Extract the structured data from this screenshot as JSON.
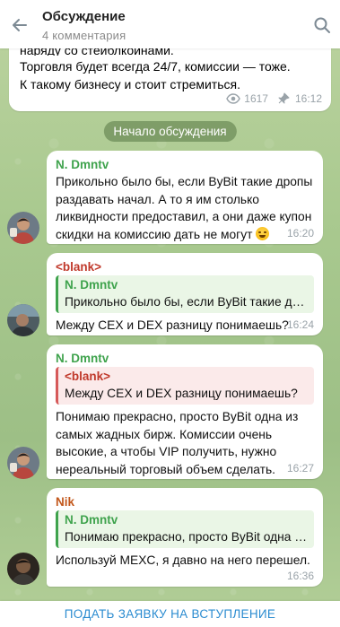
{
  "header": {
    "title": "Обсуждение",
    "subtitle": "4 комментария"
  },
  "post": {
    "cut_line": "наряду со стейблкоинами.",
    "line1": "Торговля будет всегда 24/7, комиссии — тоже.",
    "line2": "К такому бизнесу и стоит стремиться.",
    "views": "1617",
    "time": "16:12"
  },
  "service_message": "Начало обсуждения",
  "messages": [
    {
      "author": "N. Dmntv",
      "text": "Прикольно было бы, если ByBit такие дропы раздавать начал. А то я им столько ликвидности предоставил, а они даже купон скидки на комиссию дать не могут",
      "time": "16:20"
    },
    {
      "author": "<blank>",
      "reply_author": "N. Dmntv",
      "reply_text": "Прикольно было бы, если ByBit такие дро…",
      "text": "Между CEX и DEX разницу понимаешь?",
      "time": "16:24"
    },
    {
      "author": "N. Dmntv",
      "reply_author": "<blank>",
      "reply_text": "Между CEX и DEX разницу понимаешь?",
      "text": "Понимаю прекрасно, просто ByBit одна из самых жадных бирж. Комиссии очень высокие, а чтобы VIP получить, нужно нереальный торговый объем сделать.",
      "time": "16:27"
    },
    {
      "author": "Nik",
      "reply_author": "N. Dmntv",
      "reply_text": "Понимаю прекрасно, просто ByBit одна из с…",
      "text": "Используй MEXC, я давно на него перешел.",
      "time": "16:36"
    }
  ],
  "footer": {
    "join_label": "ПОДАТЬ ЗАЯВКУ НА ВСТУПЛЕНИЕ"
  },
  "colors": {
    "accent": "#2a8bd0",
    "author_green": "#3fa34d",
    "author_red": "#c0392b",
    "author_orange": "#c2571b"
  }
}
